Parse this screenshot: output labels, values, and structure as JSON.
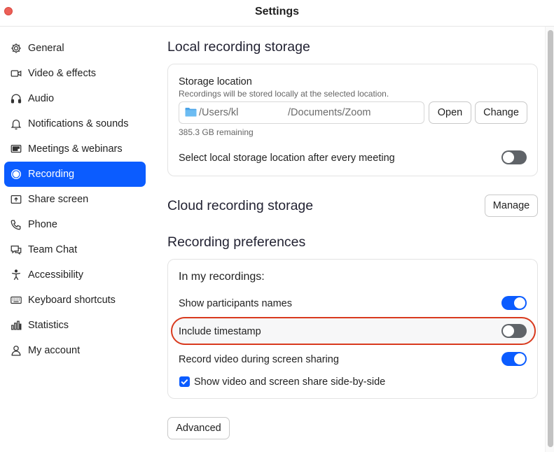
{
  "window": {
    "title": "Settings"
  },
  "sidebar": {
    "items": [
      {
        "label": "General",
        "icon": "gear-icon"
      },
      {
        "label": "Video & effects",
        "icon": "video-camera-icon"
      },
      {
        "label": "Audio",
        "icon": "headphones-icon"
      },
      {
        "label": "Notifications & sounds",
        "icon": "bell-icon"
      },
      {
        "label": "Meetings & webinars",
        "icon": "meetings-icon"
      },
      {
        "label": "Recording",
        "icon": "record-icon",
        "active": true
      },
      {
        "label": "Share screen",
        "icon": "share-screen-icon"
      },
      {
        "label": "Phone",
        "icon": "phone-icon"
      },
      {
        "label": "Team Chat",
        "icon": "chat-icon"
      },
      {
        "label": "Accessibility",
        "icon": "accessibility-icon"
      },
      {
        "label": "Keyboard shortcuts",
        "icon": "keyboard-icon"
      },
      {
        "label": "Statistics",
        "icon": "statistics-icon"
      },
      {
        "label": "My account",
        "icon": "user-icon"
      }
    ]
  },
  "local_storage": {
    "title": "Local recording storage",
    "location_label": "Storage location",
    "location_hint": "Recordings will be stored locally at the selected location.",
    "path_prefix": "/Users/kl",
    "path_suffix": "/Documents/Zoom",
    "open_label": "Open",
    "change_label": "Change",
    "remaining": "385.3 GB remaining",
    "select_each_label": "Select local storage location after every meeting",
    "select_each_on": false
  },
  "cloud_storage": {
    "title": "Cloud recording storage",
    "manage_label": "Manage"
  },
  "preferences": {
    "title": "Recording preferences",
    "subheading": "In my recordings:",
    "show_names_label": "Show participants names",
    "show_names_on": true,
    "timestamp_label": "Include timestamp",
    "timestamp_on": false,
    "record_video_label": "Record video during screen sharing",
    "record_video_on": true,
    "side_by_side_label": "Show video and screen share side-by-side",
    "side_by_side_checked": true,
    "advanced_label": "Advanced"
  },
  "colors": {
    "accent": "#0b5cff",
    "highlight_ring": "#d93a1e",
    "toggle_off": "#5f6368"
  }
}
